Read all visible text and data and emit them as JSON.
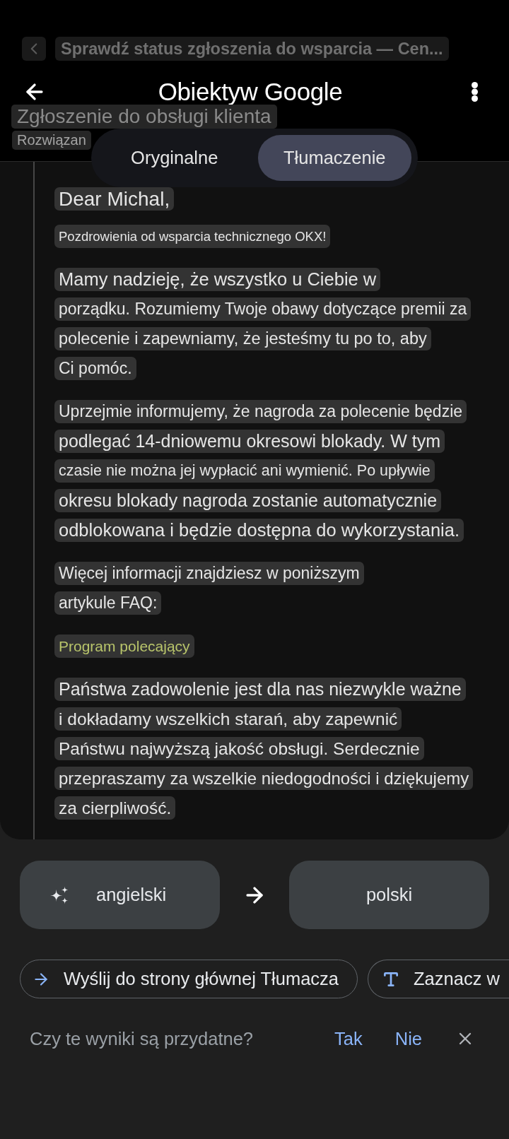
{
  "background_page": {
    "title": "Sprawdź status zgłoszenia do wsparcia — Cen...",
    "heading": "Zgłoszenie do obsługi klienta",
    "status": "Rozwiązan"
  },
  "app_bar": {
    "title": "Obiektyw Google"
  },
  "view_toggle": [
    {
      "label": "Oryginalne",
      "selected": false
    },
    {
      "label": "Tłumaczenie",
      "selected": true
    }
  ],
  "translation": [
    {
      "kind": "text",
      "lines": [
        "Dear Michal,"
      ]
    },
    {
      "kind": "text",
      "lines": [
        "Pozdrowienia od wsparcia technicznego OKX!"
      ]
    },
    {
      "kind": "text",
      "lines": [
        "Mamy nadzieję, że wszystko u Ciebie w",
        "porządku. Rozumiemy Twoje obawy dotyczące premii za",
        "polecenie i zapewniamy, że jesteśmy tu po to, aby",
        "Ci pomóc."
      ]
    },
    {
      "kind": "text",
      "lines": [
        "Uprzejmie informujemy, że nagroda za polecenie będzie",
        "podlegać 14-dniowemu okresowi blokady. W tym",
        "czasie nie można jej wypłacić ani wymienić. Po upływie",
        "okresu blokady nagroda zostanie automatycznie",
        "odblokowana i będzie dostępna do wykorzystania."
      ]
    },
    {
      "kind": "text",
      "lines": [
        "Więcej informacji znajdziesz w poniższym",
        "artykule FAQ:"
      ]
    },
    {
      "kind": "link",
      "lines": [
        "Program polecający"
      ]
    },
    {
      "kind": "text",
      "lines": [
        "Państwa zadowolenie jest dla nas niezwykle ważne",
        "i dokładamy wszelkich starań, aby zapewnić",
        "Państwu najwyższą jakość obsługi. Serdecznie",
        "przepraszamy za wszelkie niedogodności i dziękujemy",
        "za cierpliwość."
      ]
    }
  ],
  "languages": {
    "source": "angielski",
    "target": "polski"
  },
  "actions": [
    {
      "kind": "send",
      "label": "Wyślij do strony głównej Tłumacza"
    },
    {
      "kind": "select_text",
      "label": "Zaznacz w"
    }
  ],
  "feedback": {
    "question": "Czy te wyniki są przydatne?",
    "yes": "Tak",
    "no": "Nie"
  }
}
